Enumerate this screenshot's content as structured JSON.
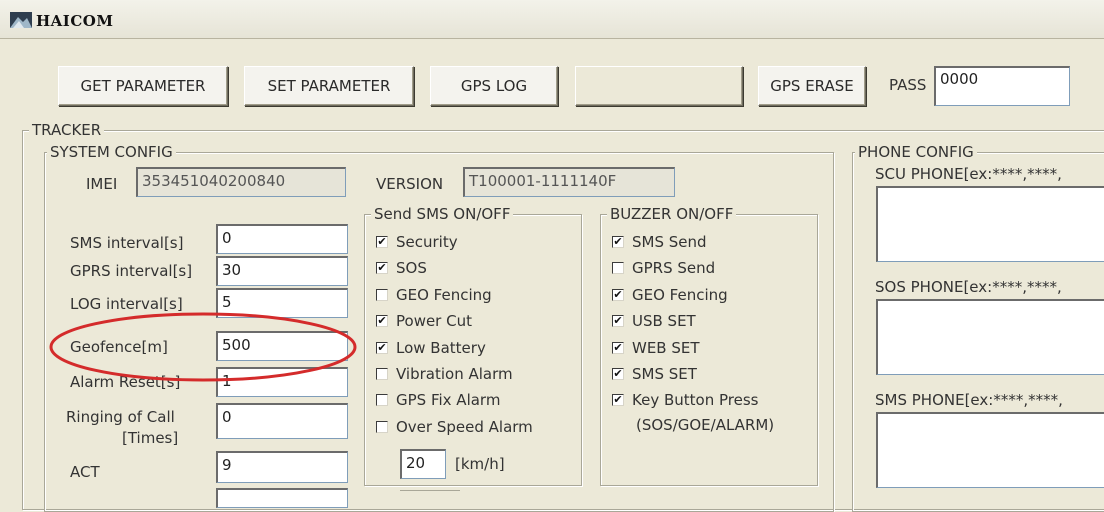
{
  "window": {
    "title": "HAICOM"
  },
  "toolbar": {
    "get_parameter": "GET PARAMETER",
    "set_parameter": "SET PARAMETER",
    "gps_log": "GPS LOG",
    "gps_erase": "GPS ERASE",
    "pass_label": "PASS",
    "pass_value": "0000"
  },
  "tracker": {
    "title": "TRACKER",
    "system_config": {
      "title": "SYSTEM CONFIG",
      "imei_label": "IMEI",
      "imei_value": "353451040200840",
      "version_label": "VERSION",
      "version_value": "T100001-1111140F",
      "fields": [
        {
          "label": "SMS interval[s]",
          "value": "0"
        },
        {
          "label": "GPRS interval[s]",
          "value": "30"
        },
        {
          "label": "LOG interval[s]",
          "value": "5"
        },
        {
          "label": "Geofence[m]",
          "value": "500"
        },
        {
          "label": "Alarm Reset[s]",
          "value": "1"
        },
        {
          "label": "Ringing of Call",
          "label2": "[Times]",
          "value": "0"
        },
        {
          "label": "ACT",
          "value": "9"
        }
      ],
      "send_sms": {
        "title": "Send SMS ON/OFF",
        "items": [
          {
            "label": "Security",
            "checked": true
          },
          {
            "label": "SOS",
            "checked": true
          },
          {
            "label": "GEO Fencing",
            "checked": false
          },
          {
            "label": "Power Cut",
            "checked": true
          },
          {
            "label": "Low Battery",
            "checked": true
          },
          {
            "label": "Vibration Alarm",
            "checked": false
          },
          {
            "label": "GPS Fix Alarm",
            "checked": false
          },
          {
            "label": "Over Speed Alarm",
            "checked": false
          }
        ],
        "speed_value": "20",
        "speed_unit": "[km/h]"
      },
      "buzzer": {
        "title": "BUZZER ON/OFF",
        "items": [
          {
            "label": "SMS Send",
            "checked": true
          },
          {
            "label": "GPRS Send",
            "checked": false
          },
          {
            "label": "GEO Fencing",
            "checked": true
          },
          {
            "label": "USB SET",
            "checked": true
          },
          {
            "label": "WEB SET",
            "checked": true
          },
          {
            "label": "SMS SET",
            "checked": true
          },
          {
            "label": "Key Button Press",
            "checked": true
          }
        ],
        "key_note": "(SOS/GOE/ALARM)"
      }
    }
  },
  "phone_config": {
    "title": "PHONE CONFIG",
    "scu_label": "SCU PHONE[ex:****,****,",
    "sos_label": "SOS PHONE[ex:****,****,",
    "sms_label": "SMS PHONE[ex:****,****,"
  },
  "colors": {
    "annotation": "#d42b2b"
  },
  "check_glyph": "✔"
}
